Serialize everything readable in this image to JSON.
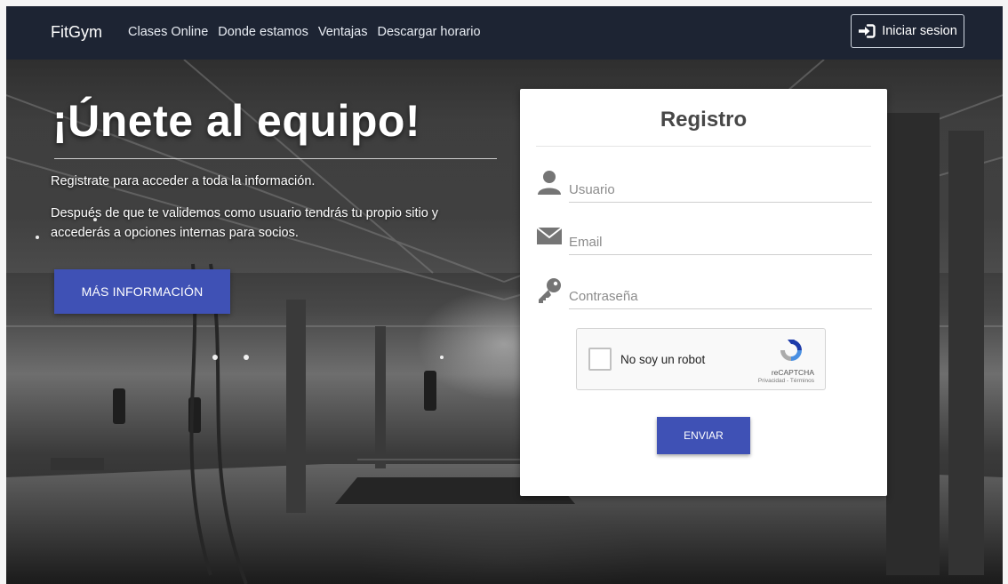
{
  "navbar": {
    "brand": "FitGym",
    "links": [
      "Clases Online",
      "Donde estamos",
      "Ventajas",
      "Descargar horario"
    ],
    "login_label": "Iniciar sesion",
    "login_icon": "sign-in-icon"
  },
  "hero": {
    "headline": "¡Únete al equipo!",
    "paragraph1": "Registrate para acceder a toda la información.",
    "paragraph2": "Después de que te validemos como usuario tendrás tu propio sitio y accederás a opciones internas para socios.",
    "more_button": "MÁS INFORMACIÓN"
  },
  "form": {
    "title": "Registro",
    "fields": [
      {
        "placeholder": "Usuario",
        "icon": "user-icon"
      },
      {
        "placeholder": "Email",
        "icon": "envelope-icon"
      },
      {
        "placeholder": "Contraseña",
        "icon": "key-icon"
      }
    ],
    "captcha": {
      "label": "No soy un robot",
      "brand": "reCAPTCHA",
      "terms": "Privacidad - Términos"
    },
    "submit_label": "ENVIAR"
  },
  "colors": {
    "navbar_bg": "#1d2433",
    "primary": "#3f51b5",
    "card_bg": "#ffffff"
  }
}
